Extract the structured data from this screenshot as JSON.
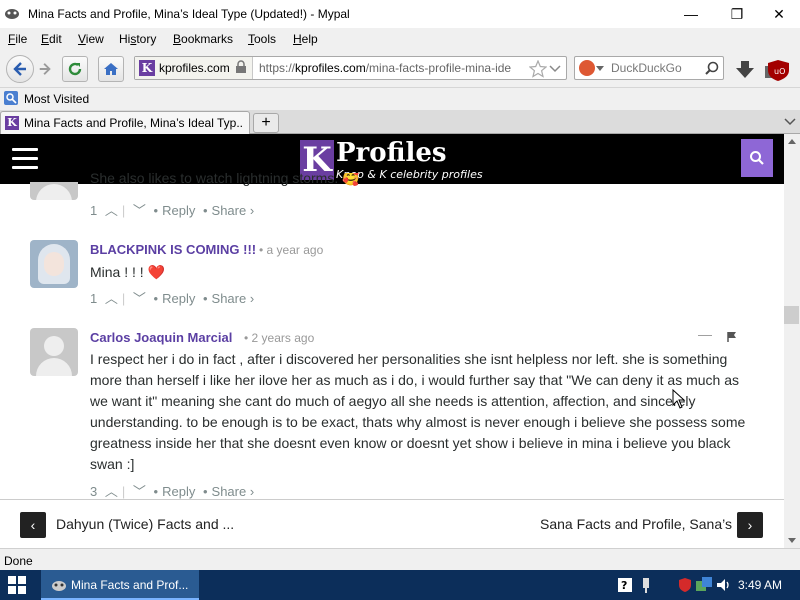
{
  "window": {
    "title": "Mina Facts and Profile, Mina’s Ideal Type (Updated!) - Mypal",
    "minimize": "—",
    "restore": "❐",
    "close": "✕"
  },
  "menu": [
    {
      "key": "F",
      "rest": "ile"
    },
    {
      "key": "E",
      "rest": "dit"
    },
    {
      "key": "V",
      "rest": "iew"
    },
    {
      "key": "",
      "pre": "Hi",
      "key2": "s",
      "rest": "tory"
    },
    {
      "key": "B",
      "rest": "ookmarks"
    },
    {
      "key": "T",
      "rest": "ools"
    },
    {
      "key": "H",
      "rest": "elp"
    }
  ],
  "nav": {
    "domain": "kprofiles.com",
    "url_prefix": "https://",
    "url_host": "kprofiles.com",
    "url_path": "/mina-facts-profile-mina-ide",
    "search_placeholder": "DuckDuckGo"
  },
  "bookmarks": {
    "most_visited": "Most Visited"
  },
  "tab": {
    "label": "Mina Facts and Profile, Mina’s Ideal Typ...",
    "new": "+"
  },
  "site": {
    "logo_k": "K",
    "logo_word": "Profiles",
    "logo_tag": "Kpop & K celebrity profiles"
  },
  "comments": [
    {
      "text": "She also likes to watch lightning storms. 🥰",
      "votes": "1",
      "reply": "Reply",
      "share": "Share ›"
    },
    {
      "name": "BLACKPINK IS COMING !!!",
      "time": "• a year ago",
      "text": "Mina ! ! ! ❤️",
      "votes": "1",
      "reply": "Reply",
      "share": "Share ›"
    },
    {
      "name": "Carlos Joaquin Marcial",
      "time": "• 2 years ago",
      "text": "I respect her i do in fact , after i discovered her personalities she isnt helpless nor left. she is something more than herself i like her ilove her as much as i do, i would further say that \"We can deny it as much as we want it\" meaning she cant do much of aegyo all she needs is attention, affection, and sincerely understanding. to be enough is to be exact, thats why almost is never enough i believe she possess some greatness inside her that she doesnt even know or doesnt yet show i believe in mina i believe you black swan :]",
      "votes": "3",
      "reply": "Reply",
      "share": "Share ›"
    }
  ],
  "postnav": {
    "prev": "Dahyun (Twice) Facts and ...",
    "next": "Sana Facts and Profile, Sana’s I"
  },
  "status": "Done",
  "taskbar": {
    "item": "Mina Facts and Prof...",
    "clock": "3:49 AM"
  },
  "colors": {
    "brand_purple": "#6a3ea1",
    "commenter_name": "#5b3fa3",
    "site_header": "#000000"
  }
}
